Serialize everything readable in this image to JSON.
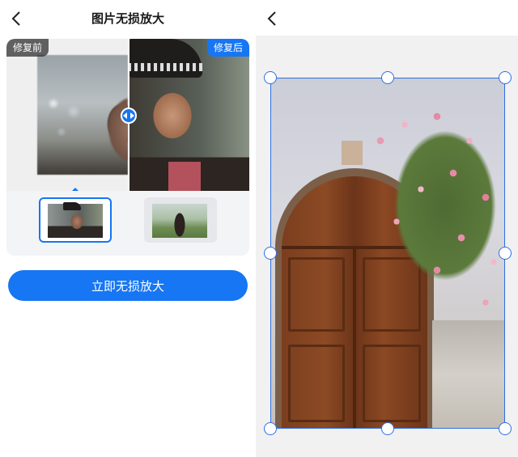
{
  "left_panel": {
    "header": {
      "title": "图片无损放大"
    },
    "compare": {
      "before_label": "修复前",
      "after_label": "修复后"
    },
    "primary_button": {
      "label": "立即无损放大"
    }
  },
  "colors": {
    "accent": "#1676f3",
    "crop_border": "#2f6fe0",
    "right_bg": "#f1f1f2"
  },
  "icons": [
    "back-chevron-icon",
    "compare-slider-icon"
  ]
}
